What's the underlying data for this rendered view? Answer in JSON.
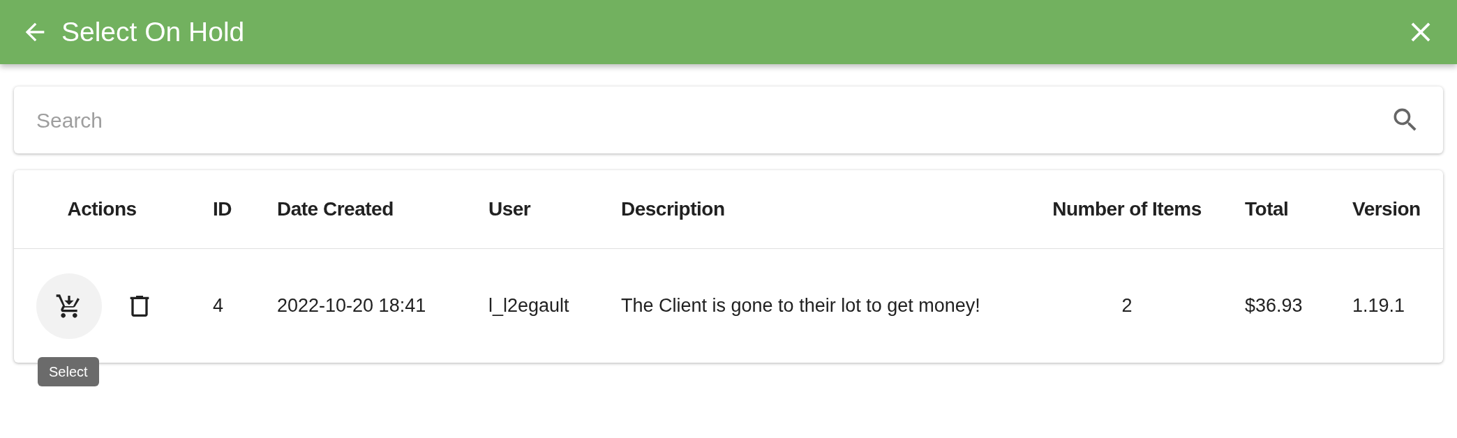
{
  "app_bar": {
    "title": "Select On Hold"
  },
  "search": {
    "placeholder": "Search"
  },
  "table": {
    "columns": [
      "Actions",
      "ID",
      "Date Created",
      "User",
      "Description",
      "Number of Items",
      "Total",
      "Version"
    ],
    "rows": [
      {
        "id": "4",
        "date_created": "2022-10-20 18:41",
        "user": "l_l2egault",
        "description": "The Client is gone to their lot to get money!",
        "number_of_items": "2",
        "total": "$36.93",
        "version": "1.19.1",
        "select_hovered": true
      }
    ]
  },
  "tooltip": {
    "text": "Select"
  }
}
